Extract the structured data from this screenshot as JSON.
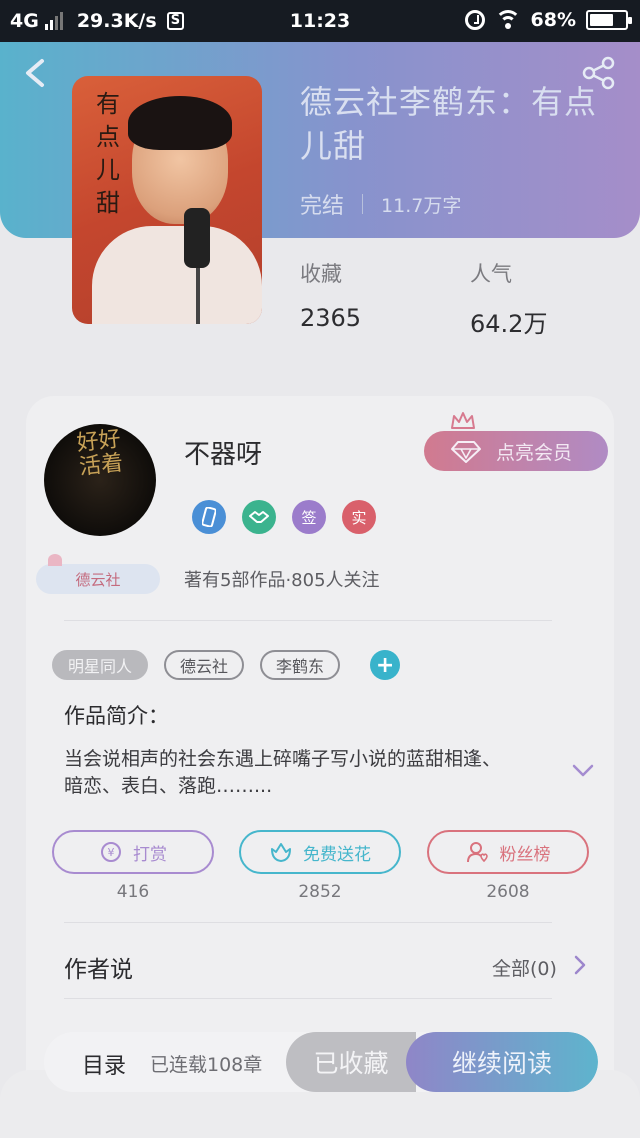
{
  "status_bar": {
    "network": "4G",
    "speed": "29.3K/s",
    "s_badge": "S",
    "time": "11:23",
    "battery": "68%",
    "battery_level": 0.68
  },
  "book": {
    "title": "德云社李鹤东：有点儿甜",
    "status": "完结",
    "word_count": "11.7万字",
    "cover_text": "有点儿甜",
    "stats": [
      {
        "label": "收藏",
        "value": "2365"
      },
      {
        "label": "人气",
        "value": "64.2万"
      }
    ]
  },
  "author": {
    "name": "不器呀",
    "avatar_text": "好好活着",
    "badges": [
      {
        "icon": "phone-badge-icon",
        "text": "",
        "color": "#4a8fd6"
      },
      {
        "icon": "handshake-badge-icon",
        "text": "",
        "color": "#3bb38e"
      },
      {
        "icon": "sign-badge-icon",
        "text": "签",
        "color": "#9b7ccb"
      },
      {
        "icon": "real-badge-icon",
        "text": "实",
        "color": "#d9606b"
      }
    ],
    "group_tag": "德云社",
    "info": "著有5部作品·805人关注",
    "vip_button": "点亮会员"
  },
  "tags": [
    "明星同人",
    "德云社",
    "李鹤东"
  ],
  "intro": {
    "title": "作品简介：",
    "text": "当会说相声的社会东遇上碎嘴子写小说的蓝甜相逢、暗恋、表白、落跑……..."
  },
  "actions": [
    {
      "label": "打赏",
      "count": "416",
      "icon": "coin-icon",
      "color": "#a88bd0"
    },
    {
      "label": "免费送花",
      "count": "2852",
      "icon": "flower-icon",
      "color": "#46b6cc"
    },
    {
      "label": "粉丝榜",
      "count": "2608",
      "icon": "fans-icon",
      "color": "#d9727d"
    }
  ],
  "author_says": {
    "title": "作者说",
    "all_link": "全部(0)"
  },
  "bottom_bar": {
    "toc_label": "目录",
    "toc_count": "已连载108章",
    "favorited": "已收藏",
    "continue_reading": "继续阅读"
  }
}
